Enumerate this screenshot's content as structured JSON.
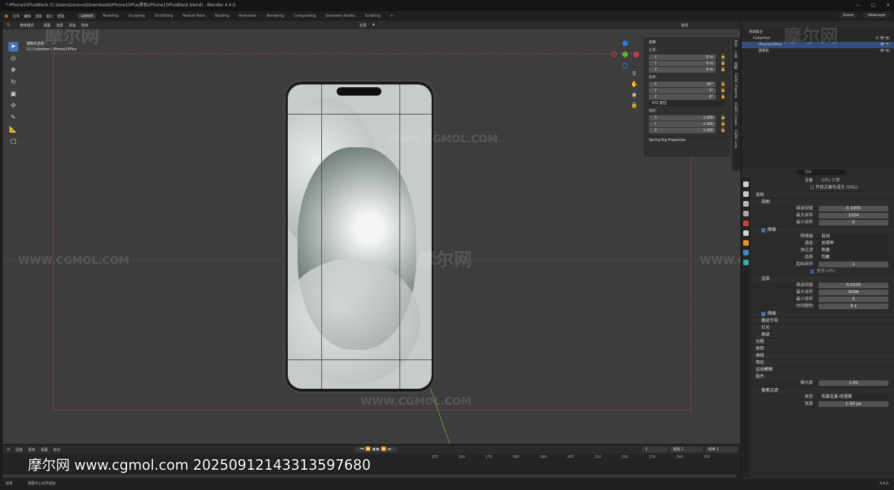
{
  "window": {
    "title": "* iPhone15PlusBlack (C:\\Users\\Lenovo\\Downloads\\iPhone15Plus黑色\\iPhone15PlusBlack.blend) - Blender 4.4.0"
  },
  "menu": [
    "文件",
    "编辑",
    "渲染",
    "窗口",
    "帮助"
  ],
  "workspaces": [
    "Layout",
    "Modeling",
    "Sculpting",
    "UV Editing",
    "Texture Paint",
    "Shading",
    "Animation",
    "Rendering",
    "Compositing",
    "Geometry Nodes",
    "Scripting"
  ],
  "active_workspace": "Layout",
  "scene": {
    "name": "Scene",
    "view_layer": "ViewLayer"
  },
  "viewport_header": {
    "mode": "物体模式",
    "items": [
      "视图",
      "选择",
      "添加",
      "物体"
    ],
    "orientation": "全局",
    "options": "选项"
  },
  "viewport_info": {
    "line1": "摄像机透视",
    "line2": "(1) Collection | iPhone15Plus"
  },
  "tools": [
    "select-box",
    "cursor",
    "move",
    "rotate",
    "scale",
    "transform",
    "annotate",
    "measure",
    "add-cube"
  ],
  "npanel": {
    "header": "变换",
    "location_label": "位置:",
    "location": [
      {
        "axis": "X",
        "value": "0 m"
      },
      {
        "axis": "Y",
        "value": "0 m"
      },
      {
        "axis": "Z",
        "value": "0 m"
      }
    ],
    "rotation_label": "旋转:",
    "rotation": [
      {
        "axis": "X",
        "value": "90°"
      },
      {
        "axis": "Y",
        "value": "0°"
      },
      {
        "axis": "Z",
        "value": "0°"
      }
    ],
    "rotation_mode": "XYZ 欧拉",
    "scale_label": "缩放:",
    "scale": [
      {
        "axis": "X",
        "value": "1.000"
      },
      {
        "axis": "Y",
        "value": "1.000"
      },
      {
        "axis": "Z",
        "value": "1.000"
      }
    ],
    "spring": "Spring Rig Properties",
    "tabs": [
      "项目",
      "工具",
      "视图",
      "CGNC Pipeline",
      "CGNC Create",
      "CGNC Link"
    ]
  },
  "timeline": {
    "menu": [
      "回放",
      "抠帧",
      "视图",
      "标记"
    ],
    "current_frame": "1",
    "start_label": "起始",
    "start": "1",
    "end_label": "结束",
    "end": "1",
    "ticks": [
      "150",
      "160",
      "170",
      "180",
      "190",
      "200",
      "210",
      "220",
      "230",
      "240",
      "250"
    ]
  },
  "statusbar": {
    "left": "选择",
    "middle": "视图中心对齐鼠标",
    "version": "4.4.0"
  },
  "outliner": {
    "rows": [
      {
        "label": "场景集合",
        "selected": false
      },
      {
        "label": "Collection",
        "selected": false
      },
      {
        "label": "iPhone15Plus",
        "selected": true
      },
      {
        "label": "摄像机",
        "selected": false
      }
    ]
  },
  "properties": {
    "search_placeholder": "搜索",
    "device_label": "设备",
    "device": "GPU 计算",
    "osl": "开放式着色语言 (OSL)",
    "sampling": "采样",
    "viewport": "视图",
    "noise_threshold_label": "噪波阈值",
    "noise_threshold": "0.1000",
    "max_samples_label": "最大采样",
    "max_samples": "1024",
    "min_samples_label": "最小采样",
    "min_samples": "0",
    "denoise": "降噪",
    "denoiser_label": "降噪器",
    "denoiser": "自动",
    "passes_label": "通道",
    "passes": "反照率",
    "prefilter_label": "预过滤",
    "prefilter": "快速",
    "quality_label": "品质",
    "quality": "均衡",
    "start_sample_label": "起始采样",
    "start_sample": "1",
    "use_gpu": "使用 GPU",
    "render": "渲染",
    "r_noise_threshold": "0.0100",
    "r_max_samples": "4096",
    "r_min_samples": "0",
    "time_limit_label": "时间限制",
    "time_limit": "0 s",
    "subsections": [
      "降噪",
      "路径引导",
      "灯光",
      "高级"
    ],
    "panels": [
      "光程",
      "体积",
      "曲线",
      "简化",
      "运动模糊",
      "胶片"
    ],
    "exposure_label": "曝光度",
    "exposure": "1.00",
    "pixel_filter": "像素过滤",
    "filter_type_label": "类型",
    "filter_type": "布莱克曼-哈里斯",
    "width_label": "宽度",
    "width": "1.50 px"
  },
  "watermarks": {
    "logo": "摩尔网",
    "site": "WWW.CGMOL.COM"
  },
  "stamp": "摩尔网 www.cgmol.com 20250912143313597680"
}
